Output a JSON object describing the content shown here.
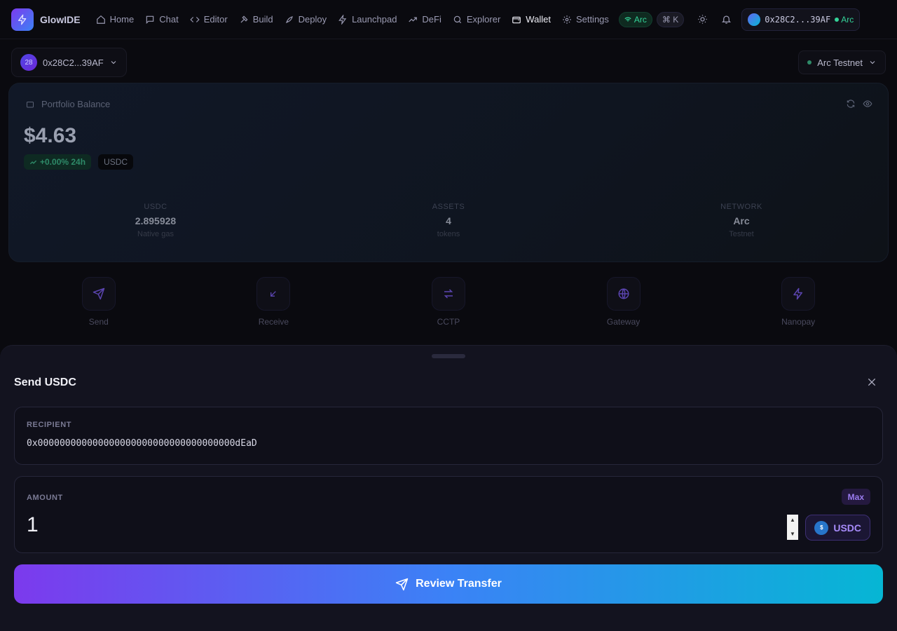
{
  "nav": {
    "brand": "GlowIDE",
    "items": [
      {
        "label": "Home",
        "icon": "home-icon"
      },
      {
        "label": "Chat",
        "icon": "chat-icon"
      },
      {
        "label": "Editor",
        "icon": "code-icon"
      },
      {
        "label": "Build",
        "icon": "hammer-icon"
      },
      {
        "label": "Deploy",
        "icon": "rocket-icon"
      },
      {
        "label": "Launchpad",
        "icon": "bolt-icon"
      },
      {
        "label": "DeFi",
        "icon": "trend-icon"
      },
      {
        "label": "Explorer",
        "icon": "search-icon"
      },
      {
        "label": "Wallet",
        "icon": "wallet-icon"
      },
      {
        "label": "Settings",
        "icon": "gear-icon"
      }
    ],
    "network_pill": "Arc",
    "shortcut": "⌘ K",
    "wallet_address": "0x28C2...39AF",
    "wallet_network": "Arc"
  },
  "account": {
    "avatar_text": "28",
    "address": "0x28C2...39AF",
    "network": "Arc Testnet"
  },
  "portfolio": {
    "label": "Portfolio Balance",
    "balance": "$4.63",
    "change": "+0.00% 24h",
    "currency": "USDC",
    "stats": [
      {
        "label": "USDC",
        "value": "2.895928",
        "sub": "Native gas"
      },
      {
        "label": "ASSETS",
        "value": "4",
        "sub": "tokens"
      },
      {
        "label": "NETWORK",
        "value": "Arc",
        "sub": "Testnet"
      }
    ]
  },
  "actions": [
    {
      "label": "Send",
      "icon": "send-icon"
    },
    {
      "label": "Receive",
      "icon": "receive-icon"
    },
    {
      "label": "CCTP",
      "icon": "swap-icon"
    },
    {
      "label": "Gateway",
      "icon": "globe-icon"
    },
    {
      "label": "Nanopay",
      "icon": "bolt-icon"
    }
  ],
  "sheet": {
    "title": "Send USDC",
    "recipient_label": "RECIPIENT",
    "recipient_value": "0x000000000000000000000000000000000000dEaD",
    "amount_label": "AMOUNT",
    "amount_value": "1",
    "max_label": "Max",
    "token_symbol": "USDC",
    "token_coin_glyph": "$",
    "review_label": "Review Transfer"
  },
  "colors": {
    "accent": "#7c3aed",
    "gradient_end": "#06b6d4",
    "success": "#34d399"
  }
}
